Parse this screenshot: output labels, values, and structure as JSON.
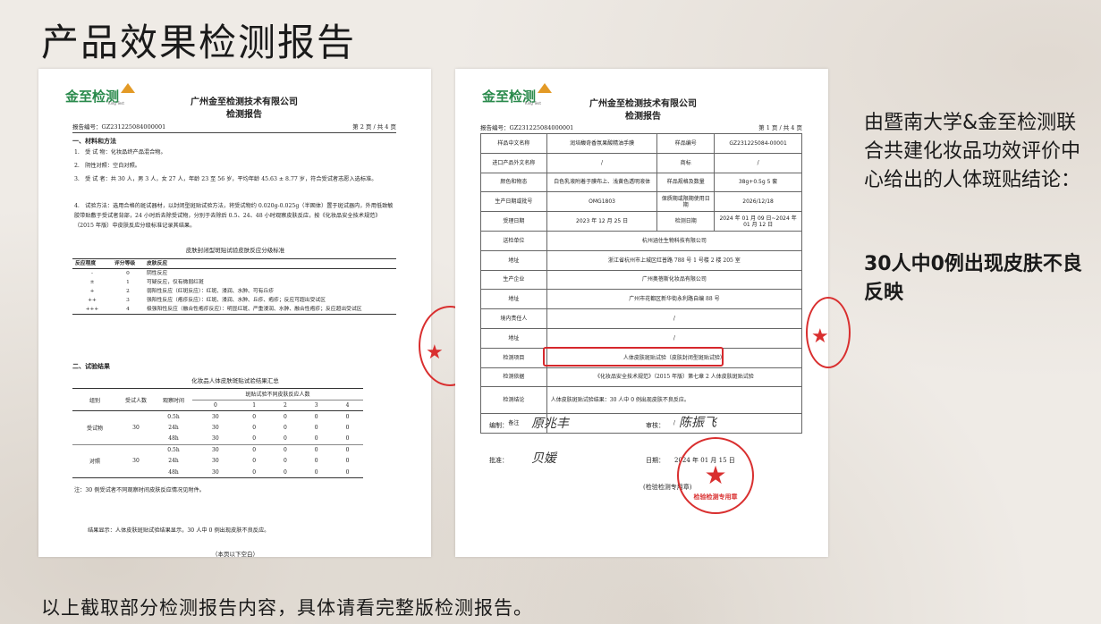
{
  "slide": {
    "title": "产品效果检测报告",
    "side_text": "由暨南大学&金至检测联合共建化妆品功效评价中心给出的人体斑贴结论：",
    "side_conclusion": "30人中0例出现皮肤不良反映",
    "footer": "以上截取部分检测报告内容，具体请看完整版检测报告。"
  },
  "logo": {
    "name": "金至检测",
    "sub": "King Test"
  },
  "left_doc": {
    "company": "广州金至检测技术有限公司",
    "report_title": "检测报告",
    "report_no": "报告编号：GZ231225084000001",
    "page": "第 2 页 / 共 4 页",
    "sec1": "一、材料和方法",
    "p1": "1.　受 试 物：化妆品终产品混合物。",
    "p2": "2.　阴性对照：空白对照。",
    "p3": "3.　受 试 者：共 30 人，男 3 人，女 27 人，年龄 23 至 56 岁，平均年龄 45.63 ± 8.77 岁，符合受试者志愿入选标准。",
    "p4": "4.　试验方法：选用合格的斑试器材，以封闭型斑贴试验方法，将受试物约 0.020g-0.025g（半固体）置于斑试器内，外用低致敏胶带贴敷于受试者背部，24 小时后去除受试物，分别于去除后 0.5、24、48 小时观察皮肤反应，按《化妆品安全技术规范》（2015 年版）中皮肤反应分级标准记录其结果。",
    "grade_caption": "皮肤封闭型斑贴试验皮肤反应分级标准",
    "grade_headers": [
      "反应程度",
      "评分等级",
      "皮肤反应"
    ],
    "grade_rows": [
      [
        "-",
        "0",
        "阴性反应"
      ],
      [
        "±",
        "1",
        "可疑反应，仅有微弱红斑"
      ],
      [
        "+",
        "2",
        "弱阳性反应（红斑反应）：红斑、浸润、水肿、可有丘疹"
      ],
      [
        "++",
        "3",
        "强阳性反应（疱疹反应）：红斑、浸润、水肿、丘疹、疱疹；反应可超出受试区"
      ],
      [
        "+++",
        "4",
        "极强阳性反应（融合性疱疹反应）：明显红斑、严重浸润、水肿、融合性疱疹；反应超出受试区"
      ]
    ],
    "sec2": "二、试验结果",
    "results_caption": "化妆品人体皮肤斑贴试验结果汇总",
    "results_headers": {
      "group": "组别",
      "count": "受试人数",
      "time": "观察时间",
      "span": "斑贴试验不同皮肤反应人数",
      "levels": [
        "0",
        "1",
        "2",
        "3",
        "4"
      ]
    },
    "results_groups": [
      {
        "name": "受试物",
        "count": "30",
        "rows": [
          {
            "time": "0.5h",
            "vals": [
              "30",
              "0",
              "0",
              "0",
              "0"
            ]
          },
          {
            "time": "24h",
            "vals": [
              "30",
              "0",
              "0",
              "0",
              "0"
            ]
          },
          {
            "time": "48h",
            "vals": [
              "30",
              "0",
              "0",
              "0",
              "0"
            ]
          }
        ]
      },
      {
        "name": "对照",
        "count": "30",
        "rows": [
          {
            "time": "0.5h",
            "vals": [
              "30",
              "0",
              "0",
              "0",
              "0"
            ]
          },
          {
            "time": "24h",
            "vals": [
              "30",
              "0",
              "0",
              "0",
              "0"
            ]
          },
          {
            "time": "48h",
            "vals": [
              "30",
              "0",
              "0",
              "0",
              "0"
            ]
          }
        ]
      }
    ],
    "note": "注：30 例受试者不同观察时间皮肤反应情况见附件。",
    "result_text": "结果显示：人体皮肤斑贴试验结果显示，30 人中 0 例出现皮肤不良反应。",
    "end": "（本页以下空白）"
  },
  "right_doc": {
    "company": "广州金至检测技术有限公司",
    "report_title": "检测报告",
    "report_no": "报告编号：GZ231225084000001",
    "page": "第 1 页 / 共 4 页",
    "r1": [
      "样品中文名称",
      "润培馥奇香氛果酸精油手膜",
      "样品编号",
      "GZ231225084-00001"
    ],
    "r2": [
      "进口产品外文名称",
      "/",
      "商标",
      "/"
    ],
    "r3": [
      "颜色和物态",
      "白色乳液附着于膜布上、浅黄色透明液体",
      "样品规格及数量",
      "38g+0.5g 5 套"
    ],
    "r4": [
      "生产日期或批号",
      "OMG1803",
      "保质期或限期使用日期",
      "2026/12/18"
    ],
    "r5": [
      "受理日期",
      "2023 年 12 月 25 日",
      "检测日期",
      "2024 年 01 月 09 日~2024 年 01 月 12 日"
    ],
    "r6": [
      "送检单位",
      "杭州涵住生物科技有限公司"
    ],
    "r7": [
      "地址",
      "浙江省杭州市上城区红普路 788 号 1 号楼 2 楼 205 室"
    ],
    "r8": [
      "生产企业",
      "广州奥蓓斯化妆品有限公司"
    ],
    "r9": [
      "地址",
      "广州市花都区新华街永利路自编 88 号"
    ],
    "r10": [
      "境内责任人",
      "/"
    ],
    "r11": [
      "地址",
      "/"
    ],
    "r12": [
      "检测项目",
      "人体皮肤斑贴试验（皮肤封闭型斑贴试验）"
    ],
    "r13": [
      "检测依据",
      "《化妆品安全技术规范》（2015 年版）第七章 2 人体皮肤斑贴试验"
    ],
    "r14": [
      "检测结论",
      "人体皮肤斑贴试验结果：30 人中 0 例出现皮肤不良反应。"
    ],
    "r15": [
      "备注",
      "/"
    ],
    "compile_label": "编制：",
    "compile_sig": "原兆丰",
    "review_label": "审核：",
    "review_sig": "陈振飞",
    "approve_label": "批准：",
    "approve_sig": "贝媛",
    "date_label": "日期：",
    "date_value": "2024 年 01 月 15 日",
    "stamp_label": "(检验检测专用章)",
    "seal_text": "检验检测专用章"
  },
  "colors": {
    "accent_red": "#d6282c",
    "logo_green": "#2a8a4c",
    "logo_orange": "#e39a26"
  }
}
